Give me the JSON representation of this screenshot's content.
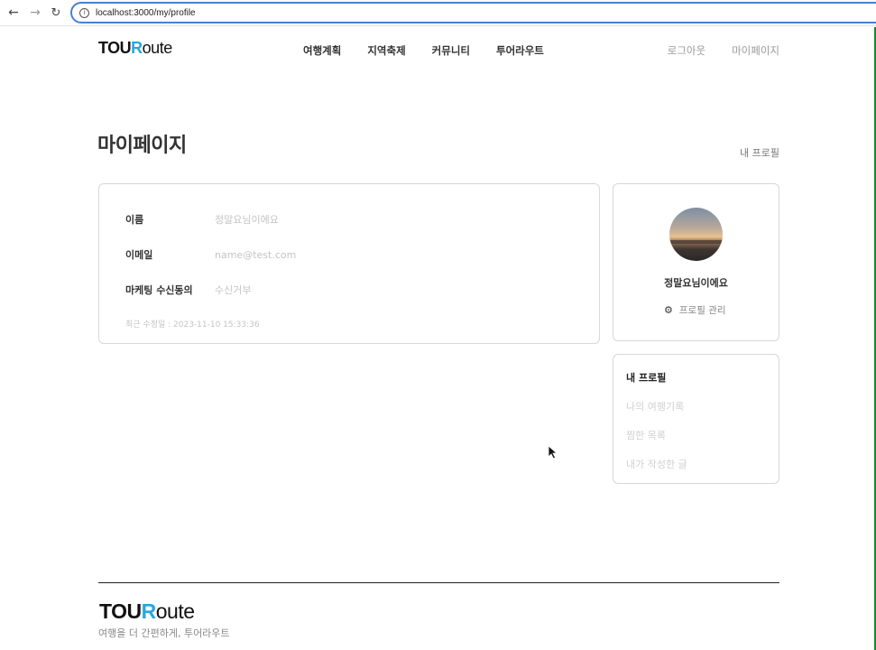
{
  "browser": {
    "url": "localhost:3000/my/profile"
  },
  "header": {
    "logo": {
      "part1": "TOU",
      "part2": "R",
      "part3": "oute"
    },
    "nav": [
      "여행계획",
      "지역축제",
      "커뮤니티",
      "투어라우트"
    ],
    "logout": "로그아웃",
    "mypage": "마이페이지"
  },
  "page": {
    "title": "마이페이지",
    "crumb": "내 프로필"
  },
  "info": {
    "rows": [
      {
        "label": "이름",
        "value": "정말요님이에요"
      },
      {
        "label": "이메일",
        "value": "name@test.com"
      },
      {
        "label": "마케팅 수신동의",
        "value": "수신거부"
      }
    ],
    "updated": "최근 수정일 : 2023-11-10 15:33:36"
  },
  "profile": {
    "name": "정말요님이에요",
    "manage_label": "프로필 관리"
  },
  "side_menu": {
    "items": [
      "내 프로필",
      "나의 여행기록",
      "찜한 목록",
      "내가 작성한 글"
    ]
  },
  "footer": {
    "logo": {
      "part1": "TOU",
      "part2": "R",
      "part3": "oute"
    },
    "slogan": "여행을 더 간편하게, 투어라우트"
  },
  "colors": {
    "accent": "#26a7e0",
    "url_focus": "#4a7fd0"
  }
}
